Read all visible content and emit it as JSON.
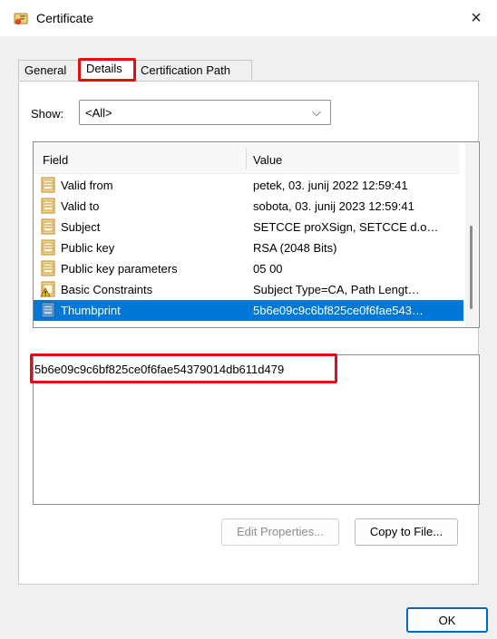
{
  "window": {
    "title": "Certificate",
    "close_glyph": "×",
    "icons": {
      "app": "certificate-icon",
      "close": "close-icon"
    }
  },
  "tabs": [
    {
      "label": "General",
      "selected": false
    },
    {
      "label": "Details",
      "selected": true
    },
    {
      "label": "Certification Path",
      "selected": false
    }
  ],
  "show": {
    "label": "Show:",
    "selected": "<All>",
    "chevron": "⌵"
  },
  "list": {
    "columns": {
      "field": "Field",
      "value": "Value"
    },
    "rows": [
      {
        "field": "Valid from",
        "value": "petek, 03. junij 2022 12:59:41",
        "icon": "field-doc-icon"
      },
      {
        "field": "Valid to",
        "value": "sobota, 03. junij 2023 12:59:41",
        "icon": "field-doc-icon"
      },
      {
        "field": "Subject",
        "value": "SETCCE proXSign, SETCCE d.o…",
        "icon": "field-doc-icon"
      },
      {
        "field": "Public key",
        "value": "RSA (2048 Bits)",
        "icon": "field-doc-icon"
      },
      {
        "field": "Public key parameters",
        "value": "05 00",
        "icon": "field-doc-icon"
      },
      {
        "field": "Basic Constraints",
        "value": "Subject Type=CA, Path Lengt…",
        "icon": "extension-warning-icon"
      },
      {
        "field": "Thumbprint",
        "value": "5b6e09c9c6bf825ce0f6fae543…",
        "icon": "field-doc-icon",
        "selected": true
      }
    ]
  },
  "detail": {
    "text": "5b6e09c9c6bf825ce0f6fae54379014db611d479"
  },
  "buttons": {
    "edit_properties": "Edit Properties...",
    "copy_to_file": "Copy to File...",
    "ok": "OK"
  },
  "colors": {
    "selection": "#0078d7",
    "highlight_box": "#e01010",
    "ok_border": "#0067c0"
  }
}
